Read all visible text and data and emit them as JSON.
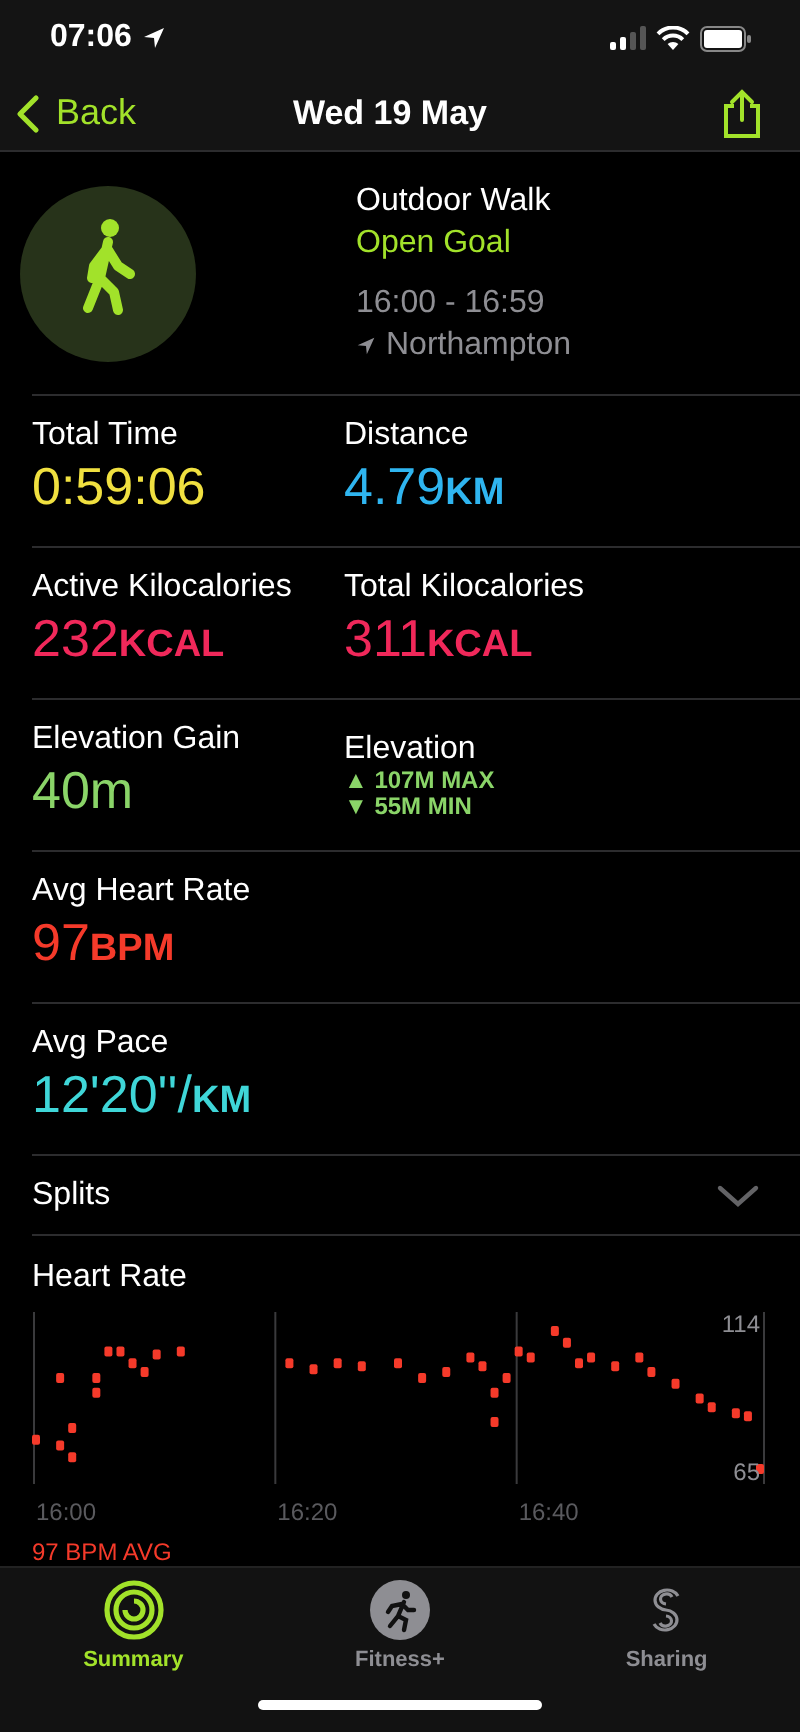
{
  "status_bar": {
    "time": "07:06"
  },
  "nav": {
    "back": "Back",
    "title": "Wed 19 May"
  },
  "workout": {
    "name": "Outdoor Walk",
    "goal": "Open Goal",
    "time_range": "16:00 - 16:59",
    "location": "Northampton"
  },
  "stat_rows": [
    [
      {
        "kind": "value",
        "label": "Total Time",
        "value": "0:59:06",
        "color": "#f0e040"
      },
      {
        "kind": "value",
        "label": "Distance",
        "value": "4.79",
        "unit": "KM",
        "color": "#2fb5f0"
      }
    ],
    [
      {
        "kind": "value",
        "label": "Active Kilocalories",
        "value": "232",
        "unit": "KCAL",
        "color": "#f0285a"
      },
      {
        "kind": "value",
        "label": "Total Kilocalories",
        "value": "311",
        "unit": "KCAL",
        "color": "#f0285a"
      }
    ],
    [
      {
        "kind": "value",
        "label": "Elevation Gain",
        "value": "40m",
        "color": "#8ad468"
      },
      {
        "kind": "range",
        "label": "Elevation",
        "max": "▲ 107M MAX",
        "min": "▼ 55M MIN",
        "color": "#8ad468"
      }
    ],
    [
      {
        "kind": "value",
        "label": "Avg Heart Rate",
        "value": "97",
        "unit": "BPM",
        "color": "#f53a2a"
      }
    ],
    [
      {
        "kind": "value",
        "label": "Avg Pace",
        "value": "12'20''/",
        "unit": "KM",
        "color": "#3fd6d8"
      }
    ]
  ],
  "splits": {
    "label": "Splits",
    "expanded": false
  },
  "heart_rate": {
    "title": "Heart Rate",
    "average": "97 BPM AVG",
    "time_labels": [
      "16:00",
      "16:20",
      "16:40"
    ],
    "scale_max": "114",
    "scale_min": "65"
  },
  "tabs": [
    {
      "label": "Summary",
      "selected": true
    },
    {
      "label": "Fitness+",
      "selected": false
    },
    {
      "label": "Sharing",
      "selected": false
    }
  ]
}
